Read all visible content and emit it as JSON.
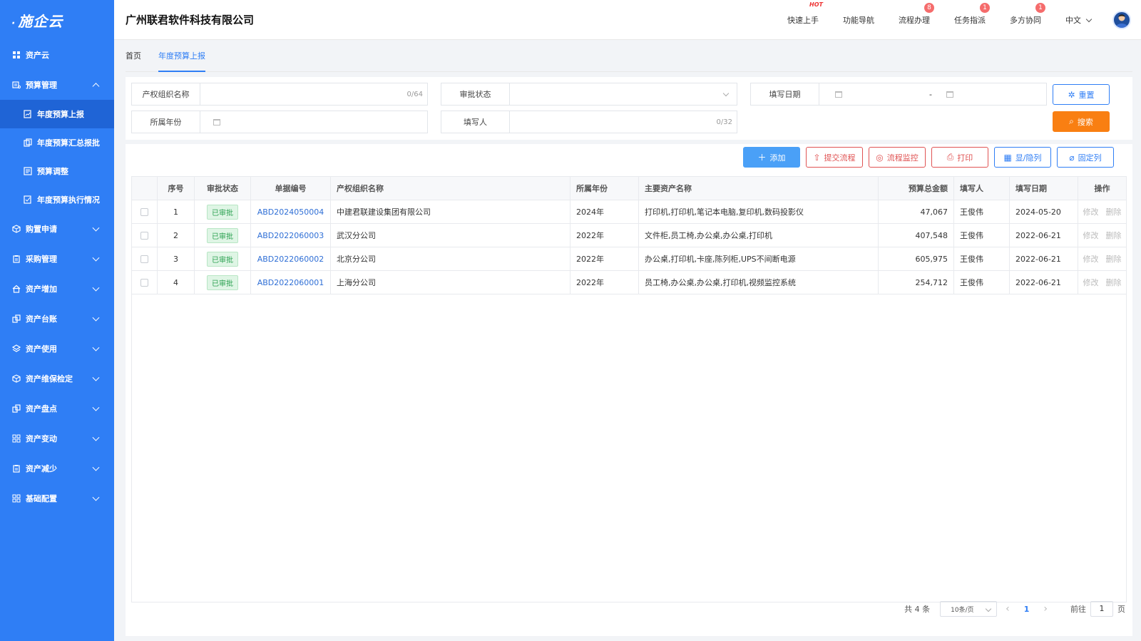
{
  "app": {
    "logo": "施企云"
  },
  "sidebar": {
    "items": [
      {
        "label": "资产云",
        "icon": "grid-icon"
      },
      {
        "label": "预算管理",
        "icon": "budget-icon",
        "expanded": true,
        "children": [
          {
            "label": "年度预算上报",
            "icon": "report-icon",
            "active": true
          },
          {
            "label": "年度预算汇总报批",
            "icon": "summary-icon"
          },
          {
            "label": "预算调整",
            "icon": "adjust-icon"
          },
          {
            "label": "年度预算执行情况",
            "icon": "execution-icon"
          }
        ]
      },
      {
        "label": "购置申请",
        "icon": "cube-icon"
      },
      {
        "label": "采购管理",
        "icon": "clipboard-icon"
      },
      {
        "label": "资产增加",
        "icon": "home-icon"
      },
      {
        "label": "资产台账",
        "icon": "ledger-icon"
      },
      {
        "label": "资产使用",
        "icon": "layers-icon"
      },
      {
        "label": "资产维保检定",
        "icon": "cube-icon"
      },
      {
        "label": "资产盘点",
        "icon": "ledger-icon"
      },
      {
        "label": "资产变动",
        "icon": "apps-icon"
      },
      {
        "label": "资产减少",
        "icon": "clipboard-icon"
      },
      {
        "label": "基础配置",
        "icon": "apps-icon"
      }
    ]
  },
  "header": {
    "company": "广州联君软件科技有限公司",
    "links": [
      {
        "label": "快速上手",
        "hot": "HOT"
      },
      {
        "label": "功能导航"
      },
      {
        "label": "流程办理",
        "badge": "8"
      },
      {
        "label": "任务指派",
        "badge": "1"
      },
      {
        "label": "多方协同",
        "badge": "1"
      }
    ],
    "language": "中文"
  },
  "tabs": [
    {
      "label": "首页",
      "active": false
    },
    {
      "label": "年度预算上报",
      "active": true
    }
  ],
  "search": {
    "org_label": "产权组织名称",
    "org_count": "0/64",
    "status_label": "审批状态",
    "date_label": "填写日期",
    "date_sep": "-",
    "year_label": "所属年份",
    "user_label": "填写人",
    "user_count": "0/32",
    "reset_label": "重置",
    "search_label": "搜索"
  },
  "toolbar": {
    "add": "添加",
    "submit": "提交流程",
    "monitor": "流程监控",
    "print": "打印",
    "columns": "显/隐列",
    "pin": "固定列"
  },
  "table": {
    "headers": [
      "序号",
      "审批状态",
      "单据编号",
      "产权组织名称",
      "所属年份",
      "主要资产名称",
      "预算总金额",
      "填写人",
      "填写日期",
      "操作"
    ],
    "rows": [
      {
        "no": "1",
        "status": "已审批",
        "code": "ABD2024050004",
        "org": "中建君联建设集团有限公司",
        "year": "2024年",
        "assets": "打印机,打印机,笔记本电脑,复印机,数码投影仪",
        "amount": "47,067",
        "user": "王俊伟",
        "date": "2024-05-20",
        "edit": "修改",
        "del": "删除"
      },
      {
        "no": "2",
        "status": "已审批",
        "code": "ABD2022060003",
        "org": "武汉分公司",
        "year": "2022年",
        "assets": "文件柜,员工椅,办公桌,办公桌,打印机",
        "amount": "407,548",
        "user": "王俊伟",
        "date": "2022-06-21",
        "edit": "修改",
        "del": "删除"
      },
      {
        "no": "3",
        "status": "已审批",
        "code": "ABD2022060002",
        "org": "北京分公司",
        "year": "2022年",
        "assets": "办公桌,打印机,卡座,陈列柜,UPS不间断电源",
        "amount": "605,975",
        "user": "王俊伟",
        "date": "2022-06-21",
        "edit": "修改",
        "del": "删除"
      },
      {
        "no": "4",
        "status": "已审批",
        "code": "ABD2022060001",
        "org": "上海分公司",
        "year": "2022年",
        "assets": "员工椅,办公桌,办公桌,打印机,视频监控系统",
        "amount": "254,712",
        "user": "王俊伟",
        "date": "2022-06-21",
        "edit": "修改",
        "del": "删除"
      }
    ]
  },
  "pager": {
    "total": "共 4 条",
    "page_size": "10条/页",
    "prev": "‹",
    "current": "1",
    "next": "›",
    "goto_label": "前往",
    "goto_value": "1",
    "goto_suffix": "页"
  },
  "colors": {
    "sidebar": "#2f7ef5",
    "sidebar_active": "#1f64d6",
    "accent": "#2f7ef5",
    "orange": "#f97f12",
    "danger": "#e05353"
  }
}
